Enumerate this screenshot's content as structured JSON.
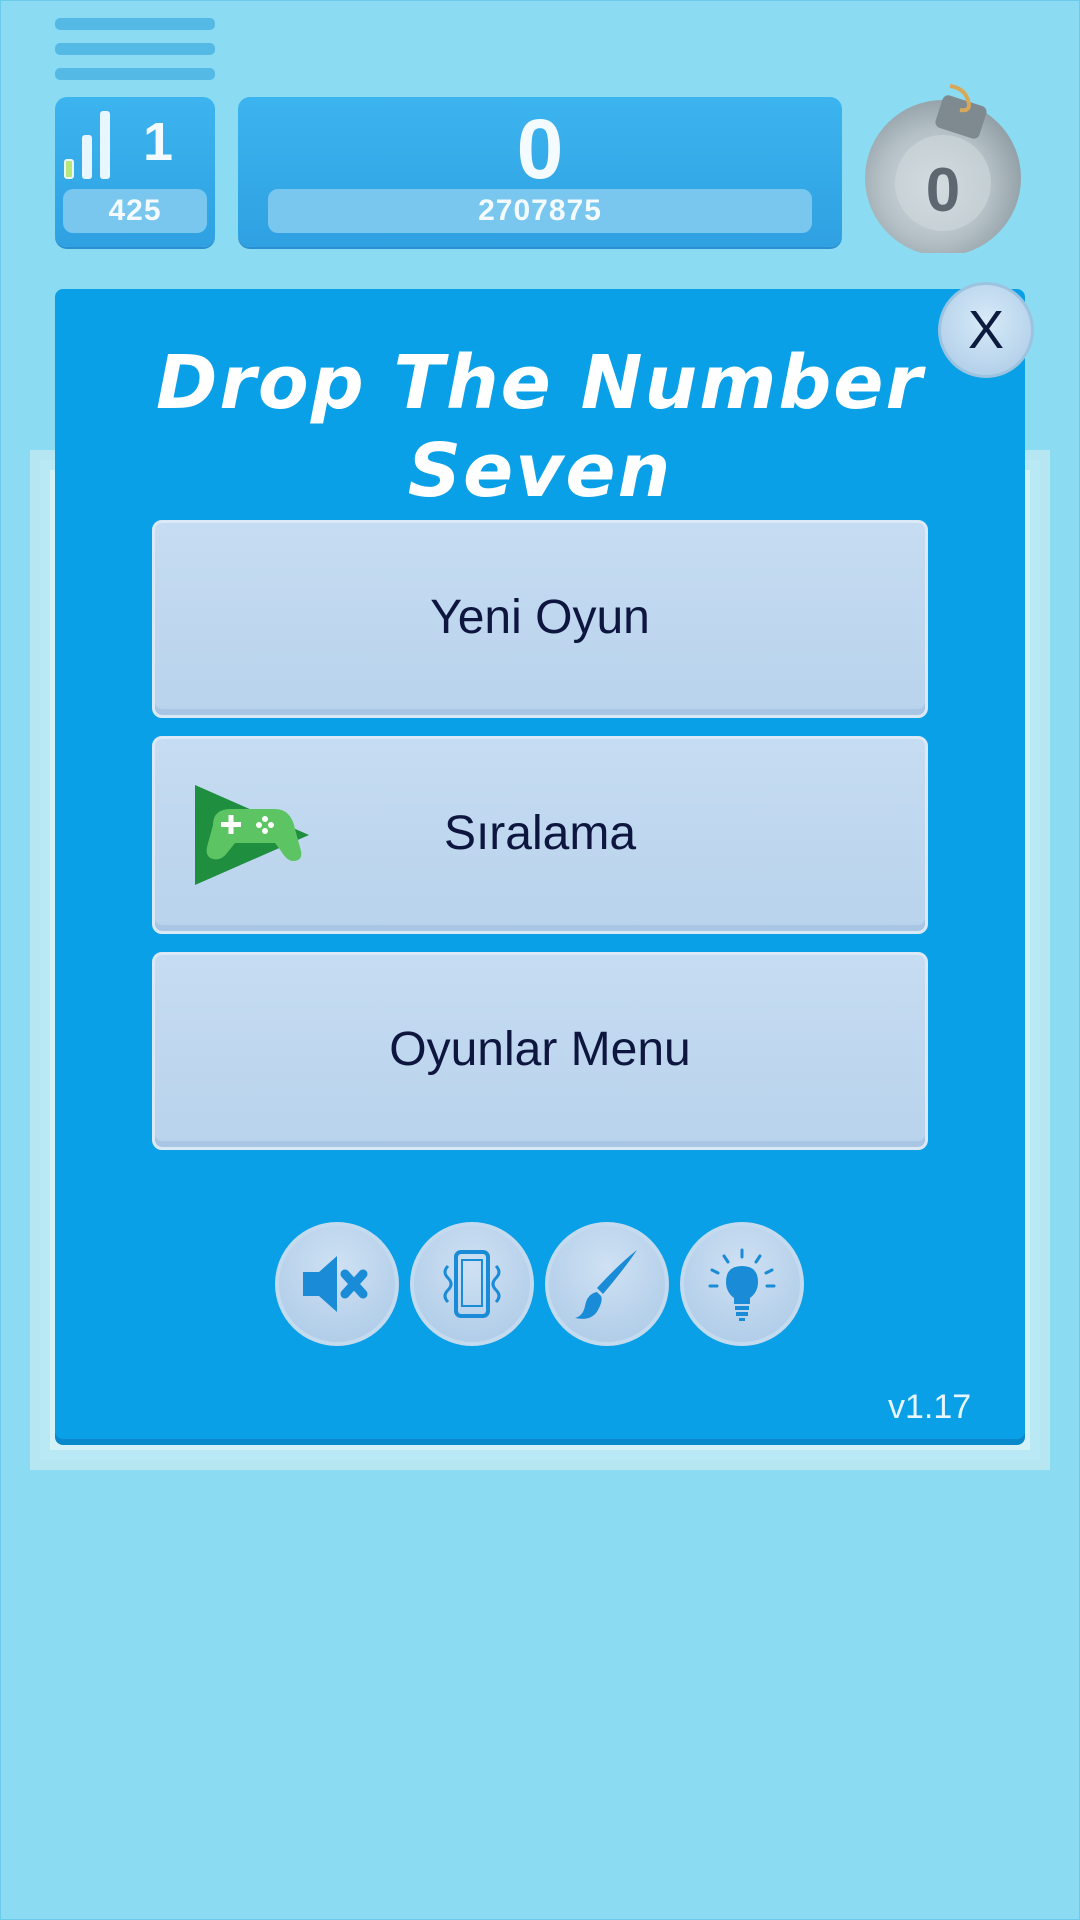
{
  "hud": {
    "level": "1",
    "level_sub": "425",
    "score": "0",
    "best_score": "2707875",
    "bombs": "0"
  },
  "modal": {
    "title_line1": "Drop The Number",
    "title_line2": "Seven",
    "close_label": "X",
    "buttons": {
      "new_game": "Yeni Oyun",
      "leaderboard": "Sıralama",
      "games_menu": "Oyunlar Menu"
    },
    "icons": [
      "sound-muted-icon",
      "vibration-icon",
      "paint-brush-icon",
      "lightbulb-icon"
    ],
    "version": "v1.17"
  },
  "colors": {
    "background": "#8bdcf3",
    "panel": "#0aa0e8",
    "button": "#c6dcf2",
    "button_text": "#0e1640"
  }
}
